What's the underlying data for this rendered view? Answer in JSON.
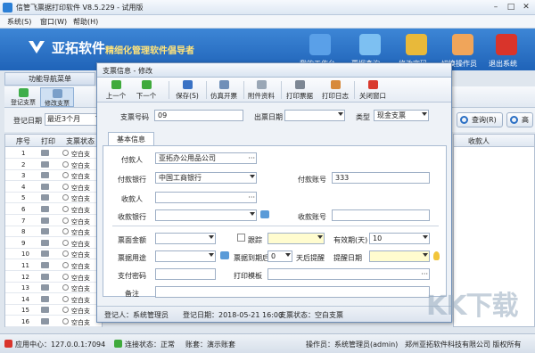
{
  "window": {
    "title": "信管飞票据打印软件 V8.5.229 - 试用版"
  },
  "menu": [
    "系统(S)",
    "窗口(W)",
    "帮助(H)"
  ],
  "banner": {
    "brand": "亚拓软件",
    "slogan": "精细化管理软件倡导者",
    "buttons": [
      "我的工作台",
      "票据查询",
      "修改密码",
      "切换操作员",
      "退出系统"
    ]
  },
  "nav": {
    "header": "功能导航菜单"
  },
  "toolstrip": {
    "buttons": [
      "登记支票",
      "修改支票"
    ]
  },
  "filter": {
    "label": "登记日期",
    "value": "最近3个月",
    "query_button": "查询(R)",
    "more_button": "高"
  },
  "grid": {
    "columns": [
      "序号",
      "打印",
      "支票状态"
    ],
    "rows": [
      {
        "no": "1",
        "status": "空白支"
      },
      {
        "no": "2",
        "status": "空白支"
      },
      {
        "no": "3",
        "status": "空白支"
      },
      {
        "no": "4",
        "status": "空白支"
      },
      {
        "no": "5",
        "status": "空白支"
      },
      {
        "no": "6",
        "status": "空白支"
      },
      {
        "no": "7",
        "status": "空白支"
      },
      {
        "no": "8",
        "status": "空白支"
      },
      {
        "no": "9",
        "status": "空白支"
      },
      {
        "no": "10",
        "status": "空白支"
      },
      {
        "no": "11",
        "status": "空白支"
      },
      {
        "no": "12",
        "status": "空白支"
      },
      {
        "no": "13",
        "status": "空白支"
      },
      {
        "no": "14",
        "status": "空白支"
      },
      {
        "no": "15",
        "status": "空白支"
      },
      {
        "no": "16",
        "status": "空白支"
      }
    ],
    "right_column": "收款人"
  },
  "modal": {
    "title": "支票信息 - 修改",
    "toolbar": [
      "上一个",
      "下一个",
      "保存(S)",
      "仿真开票",
      "附件资料",
      "打印票据",
      "打印日志",
      "关闭窗口"
    ],
    "cheque_no_label": "支票号码",
    "cheque_no": "09",
    "date_label": "出票日期",
    "date_value": "",
    "type_label": "类型",
    "type_value": "现金支票",
    "tab": "基本信息",
    "payer_label": "付款人",
    "payer": "亚拓办公用品公司",
    "payer_bank_label": "付款银行",
    "payer_bank": "中国工商银行",
    "payer_account_label": "付款账号",
    "payer_account": "333",
    "payee_label": "收款人",
    "payee": "",
    "payee_bank_label": "收款银行",
    "payee_bank": "",
    "payee_account_label": "收款账号",
    "payee_account": "",
    "amount_label": "票面金额",
    "amount": "",
    "remind_label": "跟踪",
    "validity_label": "有效期(天)",
    "validity": "10",
    "usage_label": "票据用途",
    "usage": "",
    "due_label": "票据到期后",
    "due_days": "0",
    "due_suffix": "天后提醒",
    "remind_date_label": "提醒日期",
    "pay_pwd_label": "支付密码",
    "template_label": "打印模板",
    "remark_label": "备注",
    "status": {
      "registrant": "登记人：系统管理员",
      "reg_date": "登记日期：2018-05-21 16:00",
      "cheque_status": "支票状态：空白支票"
    }
  },
  "statusbar": {
    "app_center": "应用中心：127.0.0.1:7094",
    "connection": "连接状态：正常",
    "account": "账套：演示账套",
    "operator": "操作员：系统管理员(admin)",
    "company": "郑州亚拓软件科技有限公司 版权所有"
  },
  "watermark": "KK下载",
  "colors": {
    "banner": "#2a72c8",
    "slogan": "#ffe37a",
    "modal_border": "#6f8fb8",
    "highlight_field": "#fffccf"
  }
}
